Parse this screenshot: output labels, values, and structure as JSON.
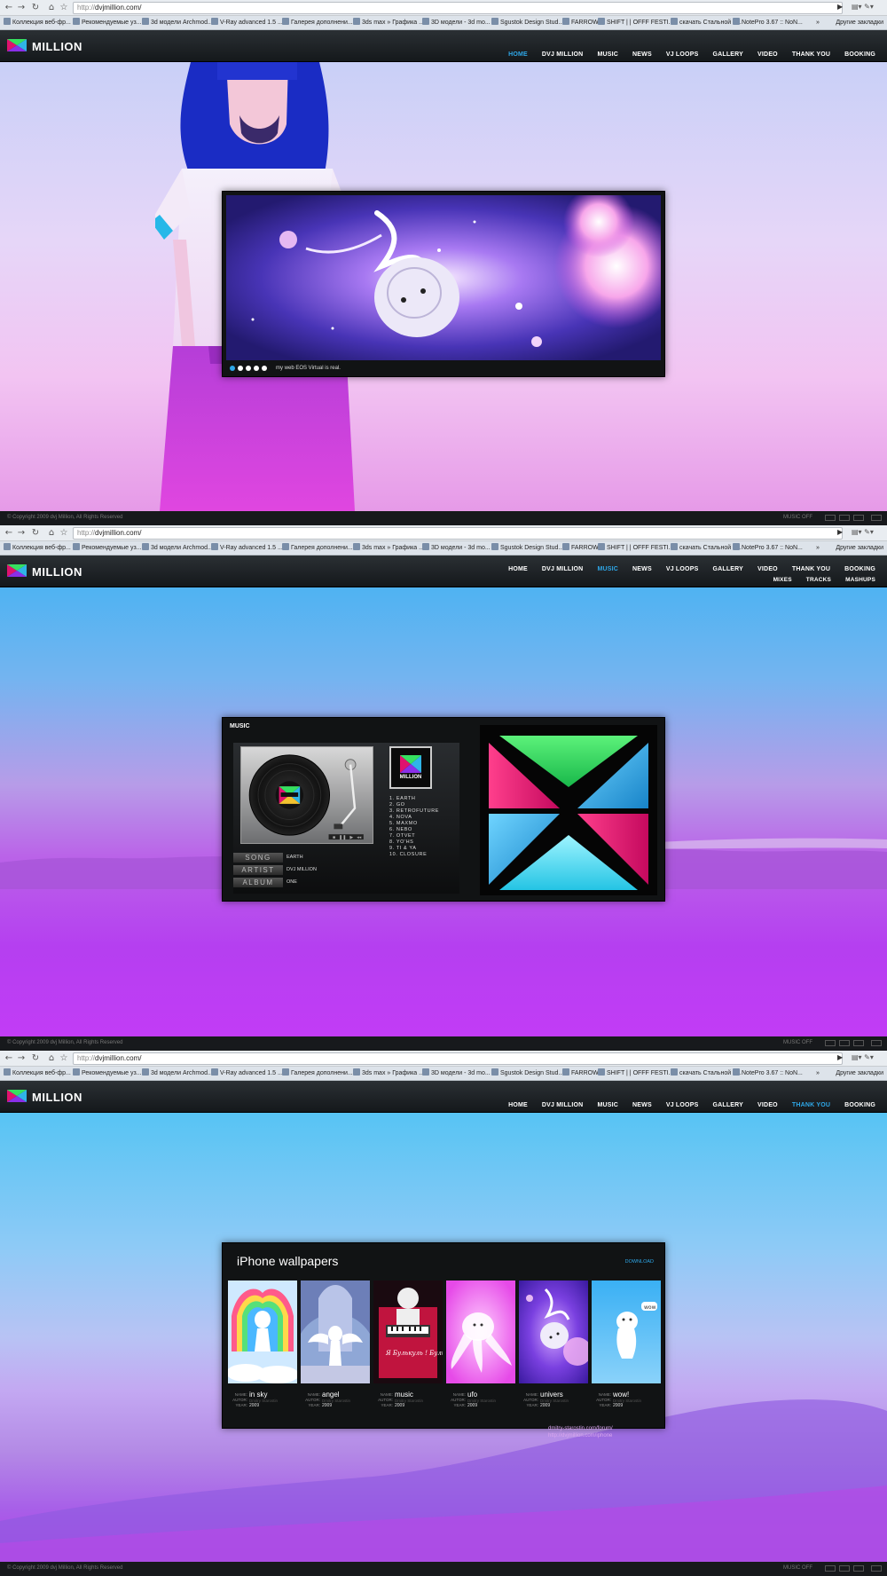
{
  "browser": {
    "url_prefix": "http://",
    "url_host": "dvjmillion.com/",
    "bookmarks": [
      "Коллекция веб-фр...",
      "Рекомендуемые уз...",
      "3d модели Archmod...",
      "V-Ray advanced 1.5 ...",
      "Галерея дополнени...",
      "3ds max » Графика ...",
      "3D модели - 3d mo...",
      "Sgustok Design Stud...",
      "FARROW",
      "SHIFT | | OFFF FESTI...",
      "скачать Стальной а...",
      "NotePro 3.67 :: NoN..."
    ],
    "other_bookmarks": "Другие закладки",
    "more": "»"
  },
  "site": {
    "logo_text": "MILLION",
    "nav": [
      "HOME",
      "DVJ MILLION",
      "MUSIC",
      "NEWS",
      "VJ LOOPS",
      "GALLERY",
      "VIDEO",
      "THANK YOU",
      "BOOKING"
    ],
    "subnav_music": [
      "MIXES",
      "TRACKS",
      "MASHUPS"
    ],
    "copyright": "© Copyright 2009 dvj Million, All Rights Reserved",
    "music_off": "MUSIC OFF",
    "brand_colors": {
      "accent": "#2ea7e8",
      "magenta": "#e0126e",
      "green": "#36e060",
      "cyan": "#2fb4e8"
    }
  },
  "home": {
    "active_nav": "HOME",
    "slider_caption": "my web EOS Virtual is real.",
    "dots": 5
  },
  "music": {
    "active_nav": "MUSIC",
    "title": "MUSIC",
    "album_logo": "MILLION",
    "tracks": [
      "1. EARTH",
      "2. GO",
      "3. RETROFUTURE",
      "4. NOVA",
      "5. MAXMO",
      "6. NEBO",
      "7. OTVET",
      "8. YO'HS",
      "9. TI & YA",
      "10. CLOSURE"
    ],
    "song_label": "SONG",
    "artist_label": "ARTIST",
    "album_label": "ALBUM",
    "song": "EARTH",
    "artist": "DVJ MILLION",
    "album": "ONE"
  },
  "thankyou": {
    "active_nav": "THANK YOU",
    "title": "iPhone wallpapers",
    "download": "DOWNLOAD",
    "label_name": "NAME:",
    "label_autor": "AUTOR:",
    "label_year": "YEAR:",
    "autor": "Dmitry Starostin",
    "wallpapers": [
      {
        "name": "in sky",
        "year": "2009"
      },
      {
        "name": "angel",
        "year": "2009"
      },
      {
        "name": "music",
        "year": "2009"
      },
      {
        "name": "ufo",
        "year": "2009"
      },
      {
        "name": "univers",
        "year": "2009"
      },
      {
        "name": "wow!",
        "year": "2009"
      }
    ],
    "thumb3_text": "Я Булькуль ! Булькуль !",
    "thumb6_bubble": "wow",
    "footnote_1": "dmitry-starostin.com/forum/",
    "footnote_2": "http://dvjmillion.com/iphone"
  }
}
